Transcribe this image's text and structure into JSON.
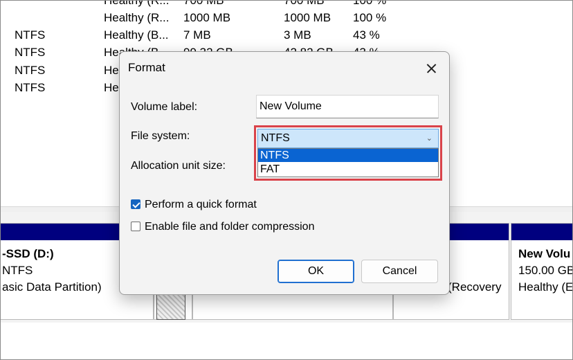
{
  "volume_list": {
    "rows": [
      {
        "fs": "",
        "status": "Healthy (R...",
        "capacity": "700 MB",
        "free": "700 MB",
        "pct": "100 %"
      },
      {
        "fs": "",
        "status": "Healthy (R...",
        "capacity": "1000 MB",
        "free": "1000 MB",
        "pct": "100 %"
      },
      {
        "fs": "NTFS",
        "status": "Healthy (B...",
        "capacity": "7 MB",
        "free": "3 MB",
        "pct": "43 %"
      },
      {
        "fs": "NTFS",
        "status": "Healthy (B...",
        "capacity": "99.32 GB",
        "free": "42.82 GB",
        "pct": "43 %"
      },
      {
        "fs": "NTFS",
        "status": "He",
        "capacity": "",
        "free": "",
        "pct": ""
      },
      {
        "fs": "NTFS",
        "status": "He",
        "capacity": "",
        "free": "",
        "pct": ""
      }
    ]
  },
  "disk_map": {
    "ssd": {
      "name": "-SSD  (D:)",
      "fs": "NTFS",
      "type": "asic Data Partition)"
    },
    "recovery": {
      "type": "(Recovery"
    },
    "new_volume": {
      "name": "New Volu",
      "size": "150.00 GB",
      "status": "Healthy (E"
    },
    "partition_color": "#00007f"
  },
  "dialog": {
    "title": "Format",
    "volume_label": {
      "label": "Volume label:",
      "value": "New Volume"
    },
    "file_system": {
      "label": "File system:",
      "selected": "NTFS",
      "options": [
        "NTFS",
        "FAT"
      ]
    },
    "allocation": {
      "label": "Allocation unit size:"
    },
    "quick_format": {
      "label": "Perform a quick format",
      "checked": true
    },
    "compression": {
      "label": "Enable file and folder compression",
      "checked": false
    },
    "ok_label": "OK",
    "cancel_label": "Cancel",
    "highlight_color": "#d9434a",
    "accent_color": "#0a64d2"
  }
}
